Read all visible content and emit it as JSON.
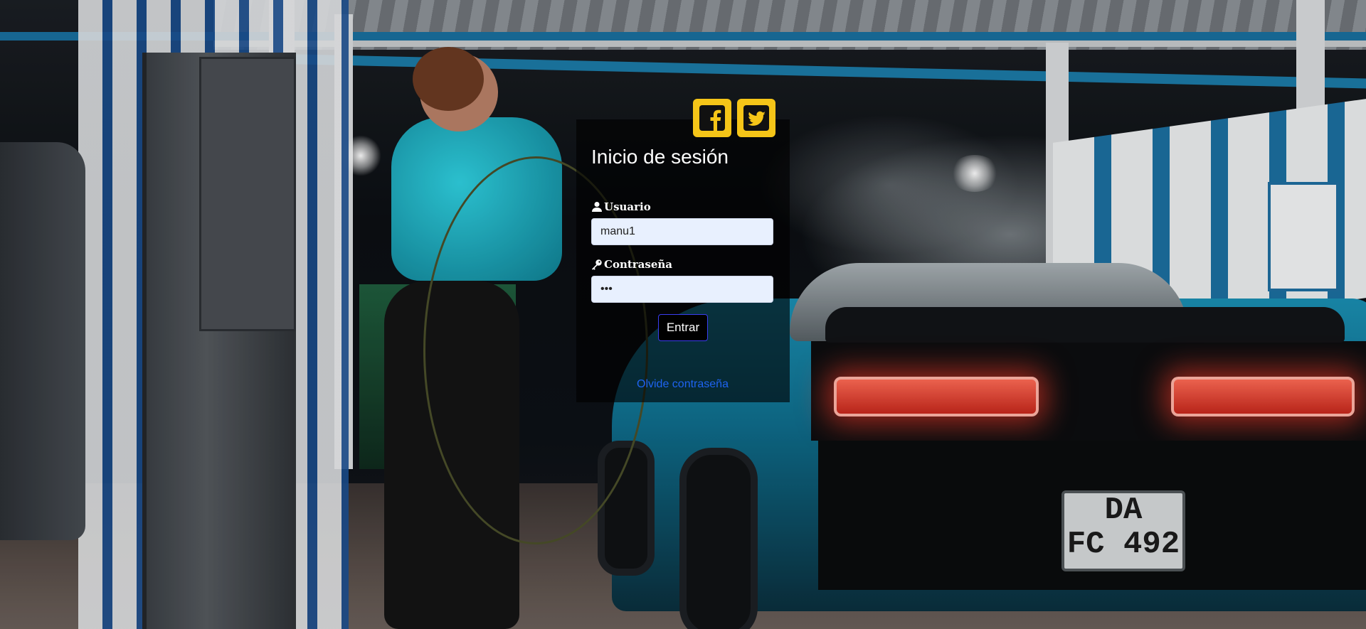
{
  "social": {
    "facebook_icon": "facebook-icon",
    "twitter_icon": "twitter-icon",
    "accent_color": "#f5c518"
  },
  "login": {
    "title": "Inicio de sesión",
    "username_label": "Usuario",
    "username_icon": "user-icon",
    "username_value": "manu1",
    "password_label": "Contraseña",
    "password_icon": "key-icon",
    "password_value": "•••",
    "submit_label": "Entrar",
    "forgot_link": "Olvide contraseña"
  },
  "background": {
    "plate_line1": "DA",
    "plate_line2": "FC 492"
  }
}
